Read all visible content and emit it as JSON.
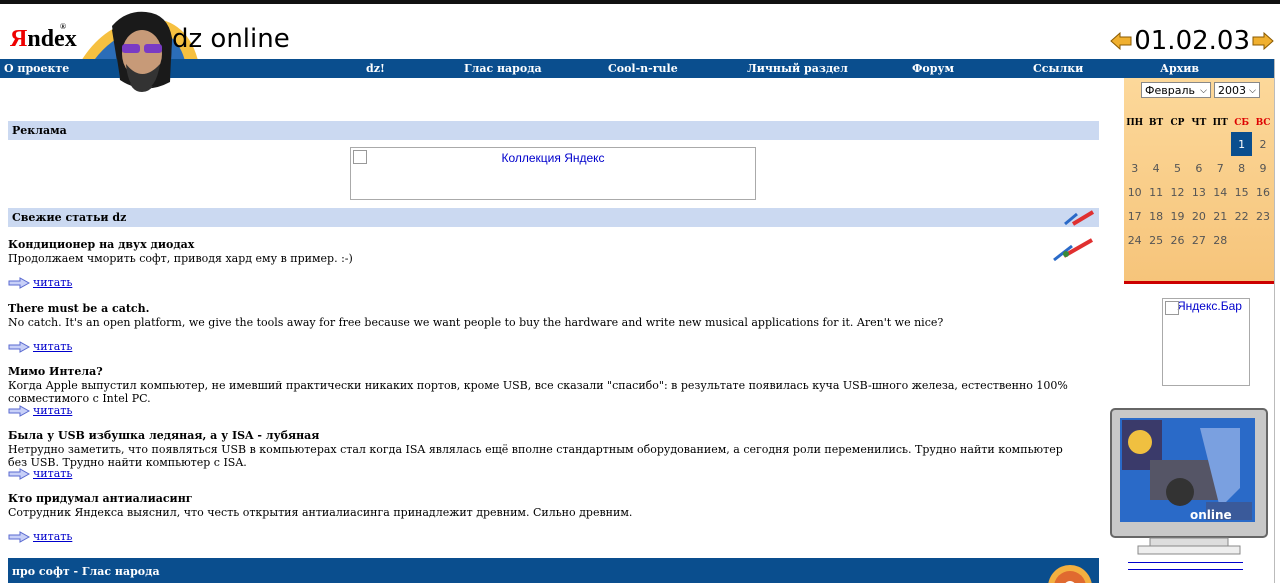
{
  "header": {
    "logo_y": "Я",
    "logo_rest": "ndex",
    "logo_reg": "®",
    "site_title": "dz online",
    "date": "01.02.03"
  },
  "nav": {
    "items": [
      "О проекте",
      "dz!",
      "Глас народа",
      "Cool-n-rule",
      "Личный раздел",
      "Форум",
      "Ссылки",
      "Архив"
    ]
  },
  "sections": {
    "ads": "Реклама",
    "fresh": "Свежие статьи dz",
    "soft": "про софт - Глас народа"
  },
  "ad": {
    "alt": "Коллекция Яндекс"
  },
  "articles": [
    {
      "title": "Кондиционер на двух диодах",
      "desc": "Продолжаем чморить софт, приводя хард ему в пример. :-)",
      "link": "читать"
    },
    {
      "title": "There must be a catch.",
      "desc": "No catch. It's an open platform, we give the tools away for free because we want people to buy the hardware and write new musical applications for it. Aren't we nice?",
      "link": "читать"
    },
    {
      "title": "Мимо Интела?",
      "desc": "Когда Apple выпустил компьютер, не имевший практически никаких портов, кроме USB, все сказали \"спасибо\": в результате появилась куча USB-шного железа, естественно 100% совместимого с Intel PC.",
      "link": "читать"
    },
    {
      "title": "Была у USB избушка ледяная, а у ISA - лубяная",
      "desc": "Нетрудно заметить, что появляться USB в компьютерах стал когда ISA являлась ещё вполне стандартным оборудованием, а сегодня роли переменились. Трудно найти компьютер без USB. Трудно найти компьютер с ISA.",
      "link": "читать"
    },
    {
      "title": "Кто придумал антиалиасинг",
      "desc": "Сотрудник Яндекса выяснил, что честь открытия антиалиасинга принадлежит древним. Сильно древним.",
      "link": "читать"
    }
  ],
  "calendar": {
    "month": "Февраль",
    "year": "2003",
    "weekdays": [
      "ПН",
      "ВТ",
      "СР",
      "ЧТ",
      "ПТ",
      "СБ",
      "ВС"
    ],
    "weeks": [
      [
        "",
        "",
        "",
        "",
        "",
        "1",
        "2"
      ],
      [
        "3",
        "4",
        "5",
        "6",
        "7",
        "8",
        "9"
      ],
      [
        "10",
        "11",
        "12",
        "13",
        "14",
        "15",
        "16"
      ],
      [
        "17",
        "18",
        "19",
        "20",
        "21",
        "22",
        "23"
      ],
      [
        "24",
        "25",
        "26",
        "27",
        "28",
        "",
        ""
      ]
    ],
    "today": "1"
  },
  "yabar": {
    "alt": "Яндекс.Бар"
  },
  "tv": {
    "caption": "online"
  },
  "colors": {
    "nav_bg": "#0a4e8e",
    "section_bg": "#cbd9f1",
    "link": "#0000cc",
    "calendar_bg": "#fcd89a",
    "weekend": "#dd0000"
  }
}
